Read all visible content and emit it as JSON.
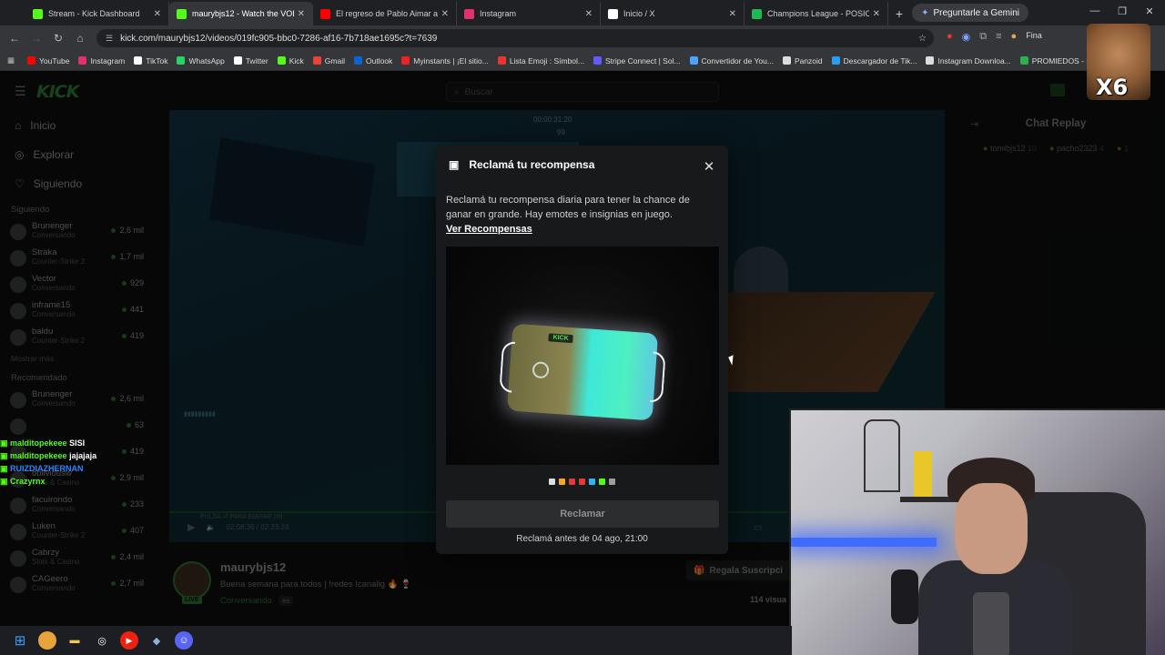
{
  "browser": {
    "tabs": [
      {
        "title": "Stream - Kick Dashboard",
        "color": "#53fc18",
        "active": false
      },
      {
        "title": "maurybjs12 - Watch the VOD o",
        "color": "#53fc18",
        "active": true
      },
      {
        "title": "El regreso de Pablo Aimar a Riv",
        "color": "#ff0000",
        "active": false
      },
      {
        "title": "Instagram",
        "color": "#e1306c",
        "active": false
      },
      {
        "title": "Inicio / X",
        "color": "#ffffff",
        "active": false
      },
      {
        "title": "Champions League - POSICION",
        "color": "#1db954",
        "active": false
      }
    ],
    "gemini_label": "Preguntarle a Gemini",
    "url": "kick.com/maurybjs12/videos/019fc905-bbc0-7286-af16-7b718ae1695c?t=7639",
    "profile_label": "Fina",
    "bookmarks": [
      {
        "label": "YouTube",
        "color": "#ff0000"
      },
      {
        "label": "Instagram",
        "color": "#e1306c"
      },
      {
        "label": "TikTok",
        "color": "#ffffff"
      },
      {
        "label": "WhatsApp",
        "color": "#25d366"
      },
      {
        "label": "Twitter",
        "color": "#ffffff"
      },
      {
        "label": "Kick",
        "color": "#53fc18"
      },
      {
        "label": "Gmail",
        "color": "#ea4335"
      },
      {
        "label": "Outlook",
        "color": "#0a64d6"
      },
      {
        "label": "Myinstants | ¡El sitio...",
        "color": "#e22"
      },
      {
        "label": "Lista Emoji : Símbol...",
        "color": "#e33"
      },
      {
        "label": "Stripe Connect | Sol...",
        "color": "#635bff"
      },
      {
        "label": "Convertidor de You...",
        "color": "#4aa3ff"
      },
      {
        "label": "Panzoid",
        "color": "#dddddd"
      },
      {
        "label": "Descargador de Tik...",
        "color": "#2a9df4"
      },
      {
        "label": "Instagram Downloa...",
        "color": "#dddddd"
      },
      {
        "label": "PROMIEDOS - Fu",
        "color": "#2bb24c"
      }
    ]
  },
  "kick": {
    "logo": "KICK",
    "search_placeholder": "Buscar",
    "nav": [
      {
        "label": "Inicio",
        "icon": "home-icon"
      },
      {
        "label": "Explorar",
        "icon": "compass-icon"
      },
      {
        "label": "Siguiendo",
        "icon": "heart-icon"
      }
    ],
    "following_header": "Siguiendo",
    "following": [
      {
        "name": "Brunenger",
        "category": "Conversando",
        "viewers": "2,6 mil"
      },
      {
        "name": "Straka",
        "category": "Counter-Strike 2",
        "viewers": "1,7 mil"
      },
      {
        "name": "Vector",
        "category": "Conversando",
        "viewers": "929"
      },
      {
        "name": "inframe15",
        "category": "Conversando",
        "viewers": "441"
      },
      {
        "name": "baldu",
        "category": "Counter-Strike 2",
        "viewers": "419"
      }
    ],
    "show_more": "Mostrar más",
    "recommended_header": "Recomendado",
    "recommended": [
      {
        "name": "Brunenger",
        "category": "Conversando",
        "viewers": "2,6 mil"
      },
      {
        "name": "",
        "category": "",
        "viewers": "63"
      },
      {
        "name": "",
        "category": "",
        "viewers": "419"
      },
      {
        "name": "obliviousw",
        "category": "Slots & Casino",
        "viewers": "2,9 mil"
      },
      {
        "name": "facuirondo",
        "category": "Conversando",
        "viewers": "233"
      },
      {
        "name": "Luken",
        "category": "Counter-Strike 2",
        "viewers": "407"
      },
      {
        "name": "Cabrzy",
        "category": "Slots & Casino",
        "viewers": "2,4 mil"
      },
      {
        "name": "CAGeero",
        "category": "Conversando",
        "viewers": "2,7 mil"
      }
    ],
    "player": {
      "timestamp": "00:00:31:20",
      "counter": "99",
      "time": "02:08:36 / 02:23:24",
      "chat_prompt": "PULSA ⏎ PARA ENVIAR UN"
    },
    "stream": {
      "channel": "maurybjs12",
      "title": "Buena semana para todos | !redes !canalig 🔥 🍷",
      "category": "Conversando",
      "language": "es",
      "live_badge": "LIVE",
      "gift_button": "Regala Suscripci",
      "viewers": "114 visua"
    },
    "chat": {
      "title": "Chat Replay",
      "users": [
        {
          "name": "tomibjs12",
          "count": "10"
        },
        {
          "name": "pacho2323",
          "count": "4"
        },
        {
          "name": "",
          "count": "1"
        }
      ]
    }
  },
  "overlay_chat": [
    {
      "user": "malditopekeee",
      "msg": "SISI",
      "color": "#53fc18"
    },
    {
      "user": "malditopekeee",
      "msg": "jajajaja",
      "color": "#53fc18"
    },
    {
      "user": "RUIZDIAZHERNAN",
      "msg": "",
      "color": "#2f86ff"
    },
    {
      "user": "Crazyrnx",
      "msg": "",
      "color": "#53fc18"
    }
  ],
  "modal": {
    "title": "Reclamá tu recompensa",
    "description": "Reclamá tu recompensa diaria para tener la chance de ganar en grande. Hay emotes e insignias en juego.",
    "link": "Ver Recompensas",
    "case_label": "KICK",
    "rarity_colors": [
      "#dddddd",
      "#f5a623",
      "#e53935",
      "#e53935",
      "#29b6f6",
      "#53fc18",
      "#9e9e9e"
    ],
    "claim_button": "Reclamar",
    "deadline": "Reclamá antes de 04 ago, 21:00"
  },
  "gif_overlay": {
    "text": "X6"
  }
}
